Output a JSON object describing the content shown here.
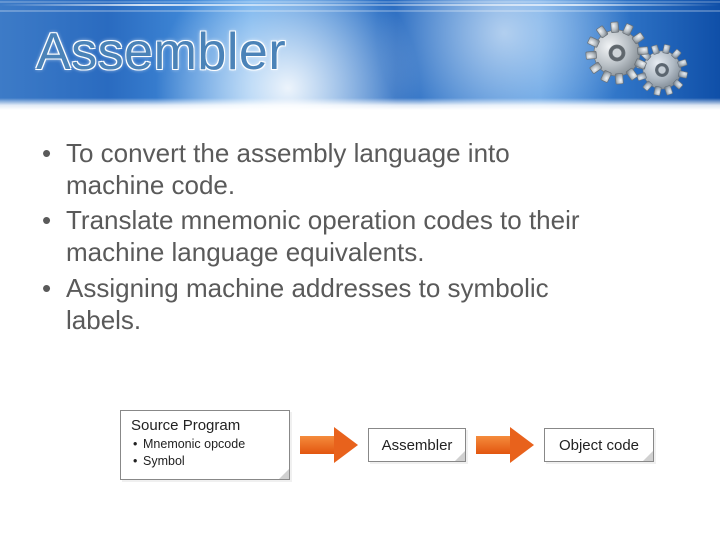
{
  "title": "Assembler",
  "bullets": [
    "To convert the assembly language into machine code.",
    "Translate mnemonic operation codes to their machine language equivalents.",
    "Assigning machine addresses to symbolic labels."
  ],
  "diagram": {
    "source_box": {
      "title": "Source Program",
      "items": [
        "Mnemonic opcode",
        "Symbol"
      ]
    },
    "middle_box": "Assembler",
    "output_box": "Object code"
  },
  "colors": {
    "title_text": "#4b83b8",
    "body_text": "#5a5a5a",
    "arrow": "#e8621c",
    "band_primary": "#2a6bc0"
  }
}
